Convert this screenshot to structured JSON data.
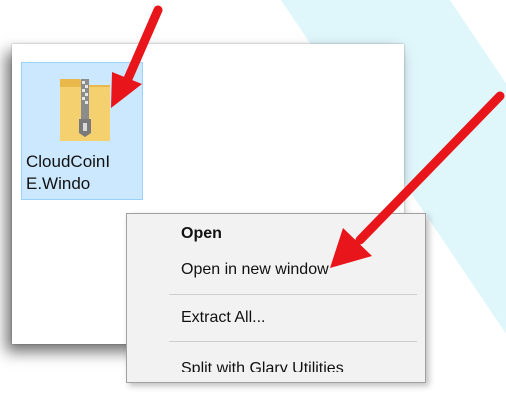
{
  "file": {
    "name": "CloudCoinI\nE.Windo",
    "icon": "zip-folder-icon"
  },
  "context_menu": {
    "items": [
      {
        "label": "Open",
        "bold": true
      },
      {
        "label": "Open in new window",
        "bold": false
      },
      {
        "label": "Extract All...",
        "bold": false
      },
      {
        "label": "Split with Glary Utilities",
        "bold": false
      }
    ]
  },
  "annotations": {
    "arrow_color": "#e8161a",
    "icons": [
      "arrow-icon",
      "arrow-icon"
    ]
  },
  "colors": {
    "selection": "#cce8ff",
    "menu_background": "#f2f2f2",
    "background_stripe": "#dff6fb"
  }
}
